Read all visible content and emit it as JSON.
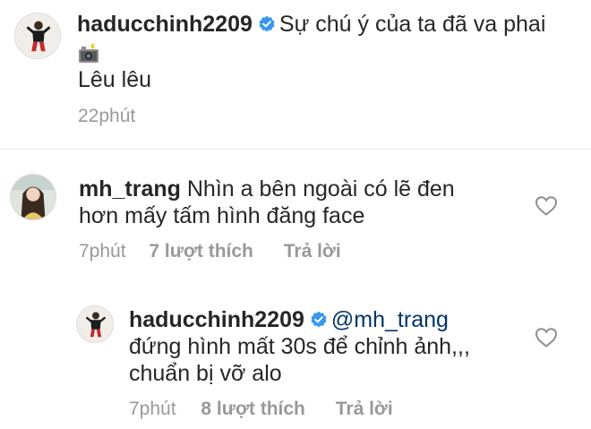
{
  "caption": {
    "username": "haducchinh2209",
    "line1": "Sự chú ý của ta đã va phai",
    "line2": "Lêu lêu",
    "time": "22phút",
    "verified_color": "#3897f0",
    "emoji_icon": "camera-with-flash-icon"
  },
  "comments": [
    {
      "username": "mh_trang",
      "text_line1": "Nhìn a bên ngoài có lẽ đen",
      "text_line2": "hơn mấy tấm hình đăng face",
      "time": "7phút",
      "likes": "7 lượt thích",
      "reply": "Trả lời"
    }
  ],
  "replies": [
    {
      "username": "haducchinh2209",
      "mention": "@mh_trang",
      "text_line1": "đứng hình mất 30s để chỉnh ảnh,,,",
      "text_line2": "chuẩn bị vỡ alo",
      "time": "7phút",
      "likes": "8 lượt thích",
      "reply": "Trả lời"
    }
  ],
  "colors": {
    "text": "#262626",
    "meta": "#999999",
    "mention": "#003569",
    "verified": "#3897f0"
  }
}
